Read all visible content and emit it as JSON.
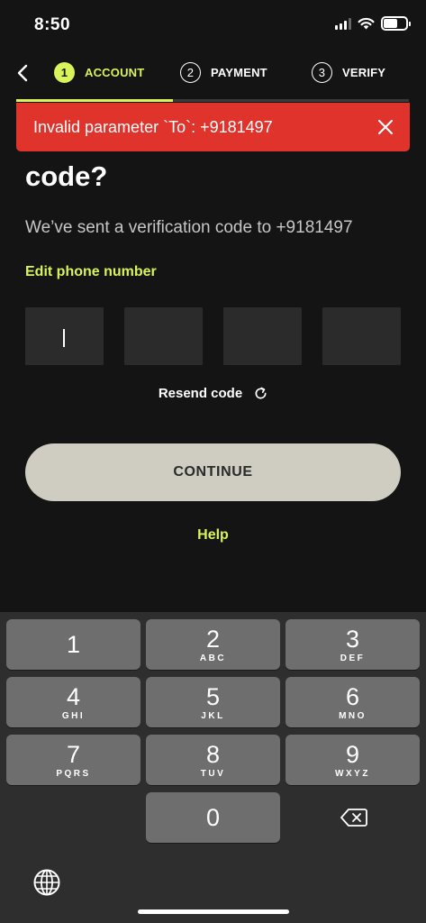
{
  "status_bar": {
    "time": "8:50",
    "icons": [
      "cellular-signal-icon",
      "wifi-icon",
      "battery-icon"
    ]
  },
  "stepper": {
    "steps": [
      {
        "number": "1",
        "label": "ACCOUNT",
        "active": true
      },
      {
        "number": "2",
        "label": "PAYMENT",
        "active": false
      },
      {
        "number": "3",
        "label": "VERIFY",
        "active": false
      }
    ],
    "progress": 0.4
  },
  "error_toast": {
    "message": "Invalid parameter `To`: +9181497"
  },
  "main": {
    "heading": "code?",
    "subtitle": "We’ve sent a verification code to +9181497",
    "edit_link": "Edit phone number",
    "otp_values": [
      "",
      "",
      "",
      ""
    ],
    "resend_label": "Resend code",
    "continue_label": "CONTINUE",
    "help_label": "Help"
  },
  "keyboard": {
    "keys": [
      {
        "digit": "1",
        "letters": ""
      },
      {
        "digit": "2",
        "letters": "ABC"
      },
      {
        "digit": "3",
        "letters": "DEF"
      },
      {
        "digit": "4",
        "letters": "GHI"
      },
      {
        "digit": "5",
        "letters": "JKL"
      },
      {
        "digit": "6",
        "letters": "MNO"
      },
      {
        "digit": "7",
        "letters": "PQRS"
      },
      {
        "digit": "8",
        "letters": "TUV"
      },
      {
        "digit": "9",
        "letters": "WXYZ"
      },
      {
        "digit": "0",
        "letters": ""
      }
    ]
  },
  "colors": {
    "background": "#141414",
    "accent": "#d9f35a",
    "error": "#e0332b",
    "button": "#cfcdc1",
    "input_box": "#2b2b2b",
    "key": "#6e6e6e"
  }
}
